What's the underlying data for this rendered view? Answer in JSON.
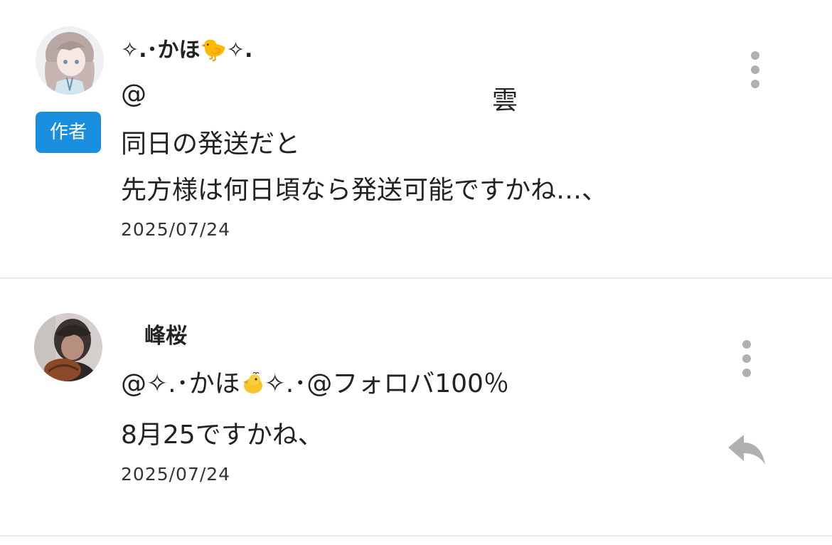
{
  "comments": [
    {
      "author": "✧.･かほ🐤✧.",
      "author_badge": "作者",
      "mention_at": "@",
      "mention_tail": "雲",
      "lines": [
        "同日の発送だと",
        "先方様は何日頃なら発送可能ですかね…、"
      ],
      "date": "2025/07/24"
    },
    {
      "author": "峰桜",
      "mention_prefix": "@✧.･かほ",
      "mention_suffix": "✧.･@フォロバ100％",
      "body": "8月25ですかね、",
      "date": "2025/07/24"
    }
  ],
  "icons": {
    "more": "kebab-menu-icon",
    "reply": "reply-arrow-icon",
    "chick": "baby-chick-emoji-icon"
  },
  "colors": {
    "badge": "#1a8fe0",
    "icon_gray": "#b0b0b0",
    "divider": "#e8e8e8"
  }
}
